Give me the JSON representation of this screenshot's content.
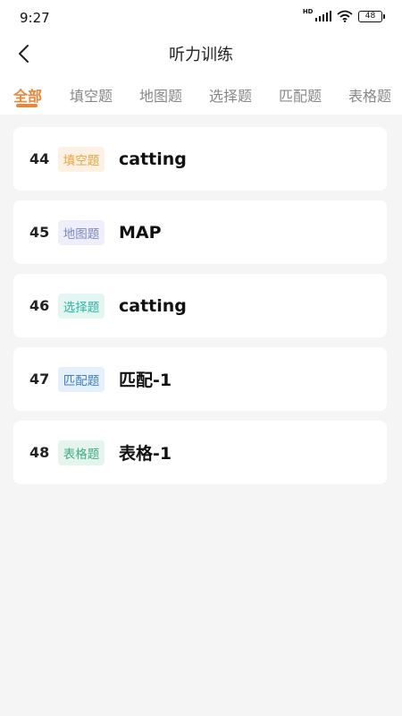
{
  "status_bar": {
    "time": "9:27",
    "network_label": "HD",
    "battery": "48"
  },
  "nav": {
    "title": "听力训练"
  },
  "tabs": [
    {
      "label": "全部",
      "active": true
    },
    {
      "label": "填空题",
      "active": false
    },
    {
      "label": "地图题",
      "active": false
    },
    {
      "label": "选择题",
      "active": false
    },
    {
      "label": "匹配题",
      "active": false
    },
    {
      "label": "表格题",
      "active": false
    }
  ],
  "items": [
    {
      "number": "44",
      "tag": "填空题",
      "title": "catting",
      "tag_color": "#e8a33d",
      "tag_bg": "#fdf1e3"
    },
    {
      "number": "45",
      "tag": "地图题",
      "title": "MAP",
      "tag_color": "#7e86c9",
      "tag_bg": "#eeeffa"
    },
    {
      "number": "46",
      "tag": "选择题",
      "title": "catting",
      "tag_color": "#2bb7a2",
      "tag_bg": "#e3f6f2"
    },
    {
      "number": "47",
      "tag": "匹配题",
      "title": "匹配-1",
      "tag_color": "#3d7fc6",
      "tag_bg": "#e6f0fa"
    },
    {
      "number": "48",
      "tag": "表格题",
      "title": "表格-1",
      "tag_color": "#3fae84",
      "tag_bg": "#e6f4ee"
    }
  ],
  "colors": {
    "accent": "#e8873a",
    "background": "#f5f5f5"
  }
}
